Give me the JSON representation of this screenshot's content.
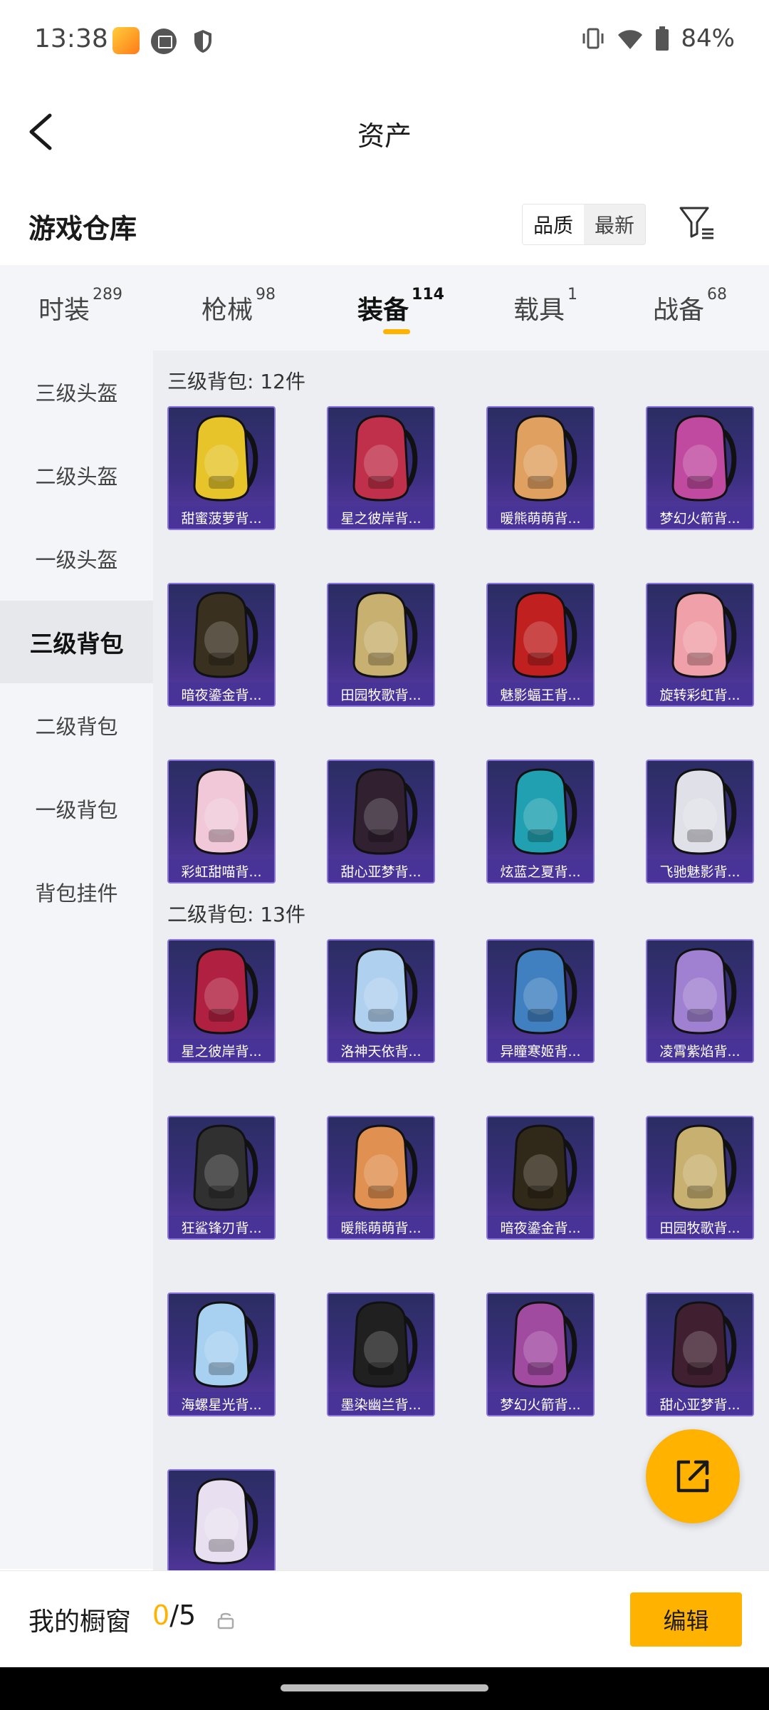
{
  "status_bar": {
    "time": "13:38",
    "battery": "84%"
  },
  "header": {
    "title": "资产"
  },
  "warehouse": {
    "title": "游戏仓库",
    "sort": {
      "quality": "品质",
      "latest": "最新"
    }
  },
  "tabs": [
    {
      "label": "时装",
      "count": "289"
    },
    {
      "label": "枪械",
      "count": "98"
    },
    {
      "label": "装备",
      "count": "114",
      "active": true
    },
    {
      "label": "载具",
      "count": "1"
    },
    {
      "label": "战备",
      "count": "68"
    }
  ],
  "sidebar": {
    "items": [
      {
        "label": "三级头盔"
      },
      {
        "label": "二级头盔"
      },
      {
        "label": "一级头盔"
      },
      {
        "label": "三级背包",
        "active": true
      },
      {
        "label": "二级背包"
      },
      {
        "label": "一级背包"
      },
      {
        "label": "背包挂件"
      }
    ]
  },
  "sections": [
    {
      "title": "三级背包: 12件",
      "items": [
        {
          "label": "甜蜜菠萝背...",
          "color": "#e6c42a"
        },
        {
          "label": "星之彼岸背...",
          "color": "#c0304a"
        },
        {
          "label": "暖熊萌萌背...",
          "color": "#e0a060"
        },
        {
          "label": "梦幻火箭背...",
          "color": "#c04aa0"
        },
        {
          "label": "暗夜鎏金背...",
          "color": "#3a3020"
        },
        {
          "label": "田园牧歌背...",
          "color": "#c8b070"
        },
        {
          "label": "魅影蝠王背...",
          "color": "#c02020"
        },
        {
          "label": "旋转彩虹背...",
          "color": "#f0a0a8"
        },
        {
          "label": "彩虹甜喵背...",
          "color": "#f0c8d8"
        },
        {
          "label": "甜心亚梦背...",
          "color": "#302030"
        },
        {
          "label": "炫蓝之夏背...",
          "color": "#20a0b0"
        },
        {
          "label": "飞驰魅影背...",
          "color": "#e0e0e8"
        }
      ]
    },
    {
      "title": "二级背包: 13件",
      "items": [
        {
          "label": "星之彼岸背...",
          "color": "#b02040"
        },
        {
          "label": "洛神天依背...",
          "color": "#b0d0f0"
        },
        {
          "label": "异瞳寒姬背...",
          "color": "#4080c0"
        },
        {
          "label": "凌霄紫焰背...",
          "color": "#a080d0"
        },
        {
          "label": "狂鲨锋刃背...",
          "color": "#303030"
        },
        {
          "label": "暖熊萌萌背...",
          "color": "#e09050"
        },
        {
          "label": "暗夜鎏金背...",
          "color": "#302818"
        },
        {
          "label": "田园牧歌背...",
          "color": "#c8b070"
        },
        {
          "label": "海螺星光背...",
          "color": "#a8d0f0"
        },
        {
          "label": "墨染幽兰背...",
          "color": "#202020"
        },
        {
          "label": "梦幻火箭背...",
          "color": "#a04aa0"
        },
        {
          "label": "甜心亚梦背...",
          "color": "#402030"
        },
        {
          "label": "",
          "color": "#e8e0f0"
        }
      ]
    }
  ],
  "bottom_bar": {
    "label": "我的橱窗",
    "current": "0",
    "separator": "/",
    "total": "5",
    "edit_label": "编辑"
  },
  "colors": {
    "accent": "#ffb300",
    "card_bg": "#3b2f80"
  }
}
